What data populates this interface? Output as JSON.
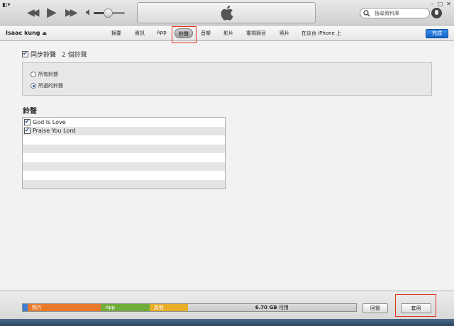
{
  "tabs": [
    "摘要",
    "資訊",
    "App",
    "鈴聲",
    "音樂",
    "影片",
    "電視節目",
    "照片",
    "在這台 iPhone 上"
  ],
  "active_tab": "鈴聲",
  "search": {
    "placeholder": "搜尋資料庫"
  },
  "device": {
    "name": "Isaac kung"
  },
  "done_label": "完成",
  "sync": {
    "label": "同步鈴聲",
    "count": "2 個鈴聲",
    "checked": true
  },
  "options": {
    "all": "所有鈴聲",
    "selected": "所選的鈴聲",
    "selected_value": "所選的鈴聲"
  },
  "ringtones": {
    "title": "鈴聲",
    "items": [
      {
        "name": "God Is Love",
        "checked": true
      },
      {
        "name": "Praise You Lord",
        "checked": true
      }
    ]
  },
  "capacity": {
    "segments": [
      {
        "label": "照片",
        "color": "#e87a2b",
        "fraction": 0.22
      },
      {
        "label": "App",
        "color": "#70ac3a",
        "fraction": 0.145
      },
      {
        "label": "其他",
        "color": "#e8ad28",
        "fraction": 0.115
      }
    ],
    "free_value": "6.70 GB",
    "free_unit": "可用",
    "music_color": "#3b80d6"
  },
  "buttons": {
    "revert": "回復",
    "apply": "套用"
  },
  "volume_level": 0.45
}
